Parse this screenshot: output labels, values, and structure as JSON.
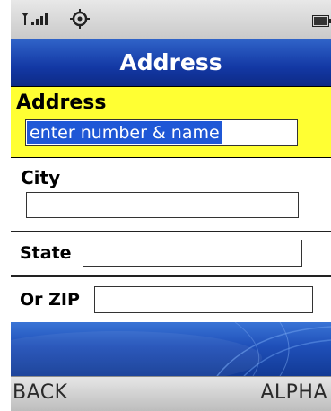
{
  "status_bar": {
    "icons": [
      "antenna-signal-icon",
      "gear-icon",
      "battery-icon"
    ]
  },
  "header": {
    "title": "Address"
  },
  "form": {
    "address": {
      "label": "Address",
      "value": "enter number & name"
    },
    "city": {
      "label": "City",
      "value": ""
    },
    "state": {
      "label": "State",
      "value": ""
    },
    "zip": {
      "label": "Or ZIP",
      "value": ""
    }
  },
  "softkeys": {
    "left": "BACK",
    "right": "ALPHA"
  },
  "colors": {
    "title_bar": "#1338a4",
    "focused_field": "#ffff33",
    "selection": "#1f57d6"
  }
}
